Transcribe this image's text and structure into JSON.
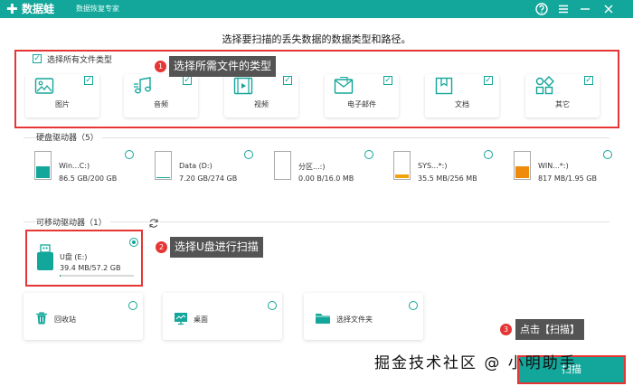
{
  "titlebar": {
    "app_name": "数据蛙",
    "subtitle": "数据恢复专家",
    "logo_glyph": "✚",
    "help_icon": "help-icon",
    "colors": {
      "accent": "#13a69a",
      "highlight": "#e53535",
      "tooltip_bg": "#545454"
    }
  },
  "heading": "选择要扫描的丢失数据的数据类型和路径。",
  "file_types": {
    "select_all_label": "选择所有文件类型",
    "items": [
      {
        "label": "图片",
        "icon": "image-icon",
        "checked": true
      },
      {
        "label": "音频",
        "icon": "music-icon",
        "checked": true
      },
      {
        "label": "视频",
        "icon": "video-icon",
        "checked": true
      },
      {
        "label": "电子邮件",
        "icon": "email-icon",
        "checked": true
      },
      {
        "label": "文档",
        "icon": "document-icon",
        "checked": true
      },
      {
        "label": "其它",
        "icon": "apps-icon",
        "checked": true
      }
    ]
  },
  "annotations": {
    "step1_num": "1",
    "step1_text": "选择所需文件的类型",
    "step2_num": "2",
    "step2_text": "选择U盘进行扫描",
    "step3_num": "3",
    "step3_text": "点击【扫描】"
  },
  "hard_drives": {
    "title": "硬盘驱动器（5）",
    "items": [
      {
        "name": "Win...C:)",
        "size": "86.5 GB/200 GB",
        "fill": 0.43,
        "fill_color": "#13a69a"
      },
      {
        "name": "Data (D:)",
        "size": "7.20 GB/274 GB",
        "fill": 0.03,
        "fill_color": "#13a69a"
      },
      {
        "name": "分区...:)",
        "size": "0.00 B/16.0 MB",
        "fill": 0.0,
        "fill_color": "#13a69a"
      },
      {
        "name": "SYS...*:)",
        "size": "35.5 MB/256 MB",
        "fill": 0.14,
        "fill_color": "#f0a30a"
      },
      {
        "name": "WIN...*:)",
        "size": "817 MB/1.95 GB",
        "fill": 0.42,
        "fill_color": "#f08a0a"
      }
    ]
  },
  "removable": {
    "title": "可移动驱动器（1）",
    "refresh_icon": "refresh-icon",
    "drive": {
      "name": "U盘 (E:)",
      "size": "39.4 MB/57.2 GB",
      "icon": "usb-icon",
      "selected": true
    }
  },
  "locations": [
    {
      "label": "回收站",
      "icon": "recycle-bin-icon"
    },
    {
      "label": "桌面",
      "icon": "desktop-icon"
    },
    {
      "label": "选择文件夹",
      "icon": "folder-icon"
    }
  ],
  "scan_button": {
    "label": "扫描"
  },
  "watermark": "掘金技术社区 @ 小明助手"
}
